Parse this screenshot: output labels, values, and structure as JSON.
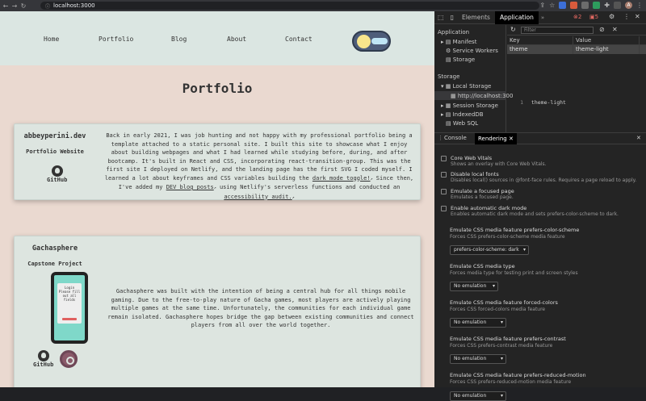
{
  "browser": {
    "url": "localhost:3000",
    "avatar": "A"
  },
  "site": {
    "nav": [
      "Home",
      "Portfolio",
      "Blog",
      "About",
      "Contact"
    ],
    "title": "Portfolio",
    "projects": [
      {
        "name": "abbeyperini.dev",
        "subtitle": "Portfolio Website",
        "github": "GitHub",
        "desc_a": "Back in early 2021, I was job hunting and not happy with my professional portfolio being a template attached to a static personal site. I built this site to showcase what I enjoy about building webpages and what I had learned while studying before, during, and after bootcamp. It's built in React and CSS, incorporating react-transition-group. This was the first site I deployed on Netlify, and the landing page has the first SVG I coded myself. I learned a lot about keyframes and CSS variables building the ",
        "link1": "dark mode toggle!",
        "desc_b": " Since then, I've added my ",
        "link2": "DEV blog posts",
        "desc_c": " using Netlify's serverless functions and conducted an ",
        "link3": "accessibility audit."
      },
      {
        "name": "Gachasphere",
        "subtitle": "Capstone Project",
        "github": "GitHub",
        "phone_text": [
          "Login",
          "Please fill",
          "out all",
          "fields"
        ],
        "desc": "Gachasphere was built with the intention of being a central hub for all things mobile gaming. Due to the free-to-play nature of Gacha games, most players are actively playing multiple games at the same time. Unfortunately, the communities for each individual game remain isolated. Gachasphere hopes bridge the gap between existing communities and connect players from all over the world together."
      }
    ]
  },
  "devtools": {
    "tabs": [
      "Elements",
      "Application"
    ],
    "errors": "2",
    "warnings": "5",
    "sidebar": {
      "app_heading": "Application",
      "items": [
        "Manifest",
        "Service Workers",
        "Storage"
      ],
      "storage_heading": "Storage",
      "storage_items": [
        "Local Storage",
        "http://localhost:300",
        "Session Storage",
        "IndexedDB",
        "Web SQL"
      ]
    },
    "filter_placeholder": "Filter",
    "table": {
      "key_header": "Key",
      "value_header": "Value",
      "rows": [
        {
          "key": "theme",
          "value": "theme-light"
        }
      ]
    },
    "preview": {
      "line": "1",
      "value": "theme-light"
    },
    "drawer_tabs": [
      "Console",
      "Rendering"
    ],
    "checks": [
      {
        "title": "Core Web Vitals",
        "sub": "Shows an overlay with Core Web Vitals."
      },
      {
        "title": "Disable local fonts",
        "sub": "Disables local() sources in @font-face rules. Requires a page reload to apply."
      },
      {
        "title": "Emulate a focused page",
        "sub": "Emulates a focused page."
      },
      {
        "title": "Enable automatic dark mode",
        "sub": "Enables automatic dark mode and sets prefers-color-scheme to dark."
      }
    ],
    "emulations": [
      {
        "title": "Emulate CSS media feature prefers-color-scheme",
        "sub": "Forces CSS prefers-color-scheme media feature",
        "value": "prefers-color-scheme: dark"
      },
      {
        "title": "Emulate CSS media type",
        "sub": "Forces media type for testing print and screen styles",
        "value": "No emulation"
      },
      {
        "title": "Emulate CSS media feature forced-colors",
        "sub": "Forces CSS forced-colors media feature",
        "value": "No emulation"
      },
      {
        "title": "Emulate CSS media feature prefers-contrast",
        "sub": "Forces CSS prefers-contrast media feature",
        "value": "No emulation"
      },
      {
        "title": "Emulate CSS media feature prefers-reduced-motion",
        "sub": "Forces CSS prefers-reduced-motion media feature",
        "value": "No emulation"
      }
    ]
  }
}
